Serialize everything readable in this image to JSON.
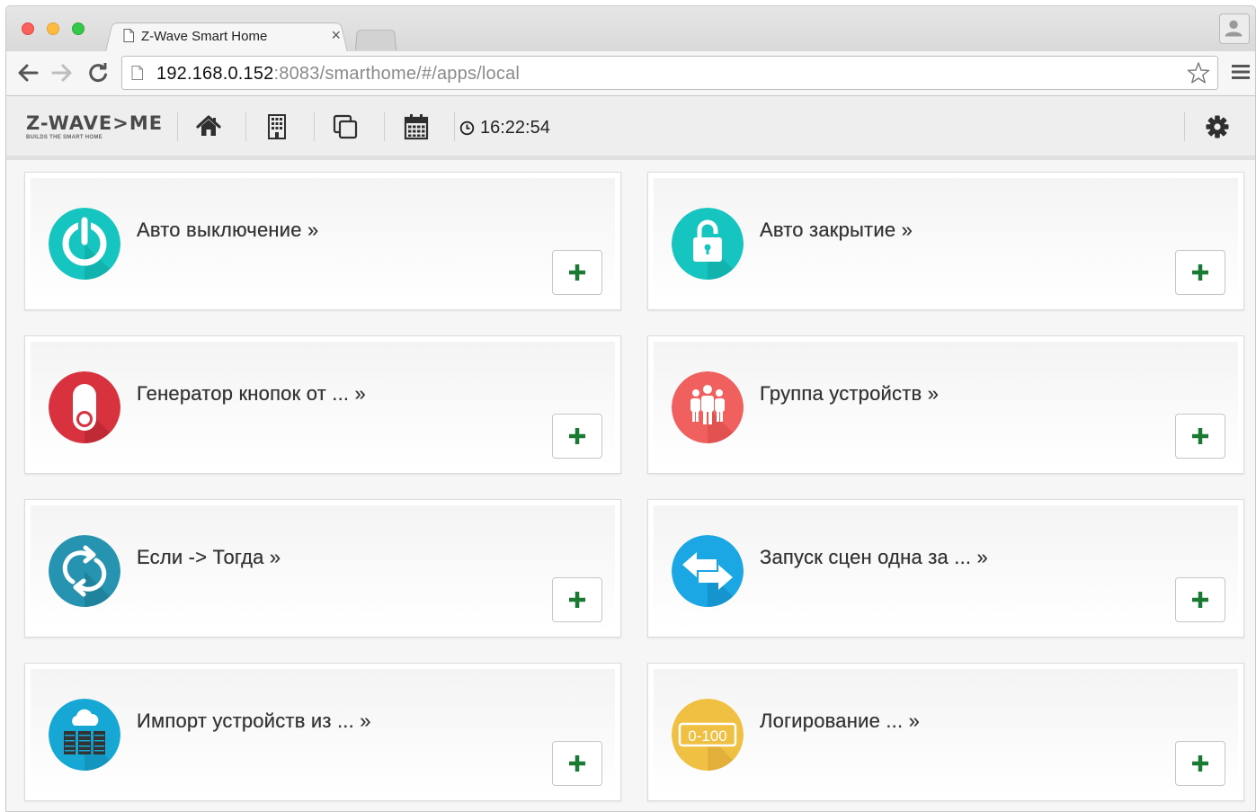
{
  "browser": {
    "tab_title": "Z-Wave Smart Home",
    "tab_close": "×",
    "url_host": "192.168.0.152",
    "url_rest": ":8083/smarthome/#/apps/local"
  },
  "app": {
    "logo_main": "Z-WAVE>ME",
    "logo_tagline": "BUILDS THE SMART HOME",
    "clock": "16:22:54"
  },
  "colors": {
    "add_plus": "#1a7a34",
    "icon_teal": "#16c4c0",
    "icon_red": "#d8323e",
    "icon_salmon": "#f0605e",
    "icon_blue_dark": "#2693b0",
    "icon_blue": "#1ba6e4",
    "icon_cyan": "#16a7d4",
    "icon_yellow": "#f0c043"
  },
  "apps": [
    {
      "title": "Авто выключение »",
      "icon": "power-icon"
    },
    {
      "title": "Авто закрытие »",
      "icon": "lock-icon"
    },
    {
      "title": "Генератор кнопок от ... »",
      "icon": "switch-icon"
    },
    {
      "title": "Группа устройств »",
      "icon": "group-icon"
    },
    {
      "title": "Если -> Тогда »",
      "icon": "refresh-icon"
    },
    {
      "title": "Запуск сцен одна за ... »",
      "icon": "swap-arrows-icon"
    },
    {
      "title": "Импорт устройств из ... »",
      "icon": "cloud-server-icon"
    },
    {
      "title": "Логирование ... »",
      "icon": "range-icon",
      "icon_text": "0-100"
    }
  ]
}
